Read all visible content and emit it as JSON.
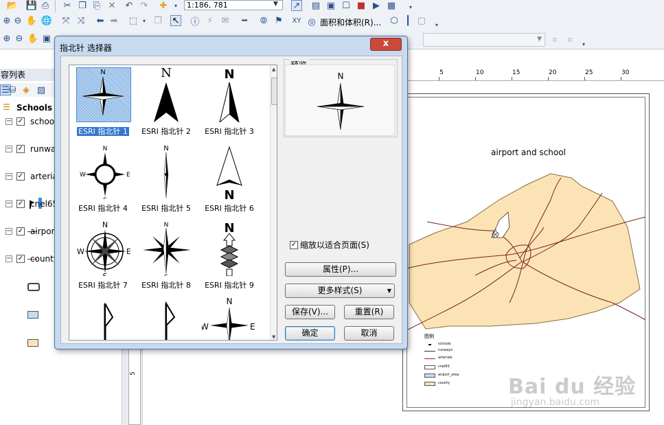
{
  "toolbar": {
    "scale_value": "1:186, 781",
    "area_tool_label": "面积和体积(R)..."
  },
  "toc": {
    "title": "容列表",
    "root_label": "Schools",
    "layers": [
      {
        "label": "schoo",
        "checked": true
      },
      {
        "label": "runwa",
        "checked": true
      },
      {
        "label": "arteria",
        "checked": true
      },
      {
        "label": "cnel65",
        "checked": true
      },
      {
        "label": "airpor",
        "checked": true
      },
      {
        "label": "county",
        "checked": true
      }
    ]
  },
  "ruler": {
    "ticks": [
      "5",
      "10",
      "15",
      "20",
      "25",
      "30"
    ],
    "vertical_mark": "5"
  },
  "map": {
    "title": "airport and school",
    "legend_title": "图例",
    "legend": [
      "schools",
      "runways",
      "arterials",
      "cnel65",
      "airport_area",
      "county"
    ]
  },
  "watermark": {
    "main": "Bai du 经验",
    "sub": "jingyan.baidu.com"
  },
  "dialog": {
    "title": "指北针 选择器",
    "close_label": "x",
    "preview_label": "预览",
    "scale_to_fit_label": "缩放以适合页面(S)",
    "scale_to_fit_checked": true,
    "buttons": {
      "properties": "属性(P)...",
      "more_styles": "更多样式(S)",
      "save": "保存(V)...",
      "reset": "重置(R)",
      "ok": "确定",
      "cancel": "取消"
    },
    "styles": [
      {
        "label": "ESRI 指北针 1",
        "selected": true
      },
      {
        "label": "ESRI 指北针 2",
        "selected": false
      },
      {
        "label": "ESRI 指北针 3",
        "selected": false
      },
      {
        "label": "ESRI 指北针 4",
        "selected": false
      },
      {
        "label": "ESRI 指北针 5",
        "selected": false
      },
      {
        "label": "ESRI 指北针 6",
        "selected": false
      },
      {
        "label": "ESRI 指北针 7",
        "selected": false
      },
      {
        "label": "ESRI 指北针 8",
        "selected": false
      },
      {
        "label": "ESRI 指北针 9",
        "selected": false
      }
    ],
    "compass_letters": {
      "n": "N",
      "s": "S",
      "e": "E",
      "w": "W"
    }
  },
  "colors": {
    "county_fill": "#fbe3b6",
    "road_color": "#7a1f1f",
    "selection_blue": "#3377cc",
    "close_red": "#c94a3a"
  }
}
